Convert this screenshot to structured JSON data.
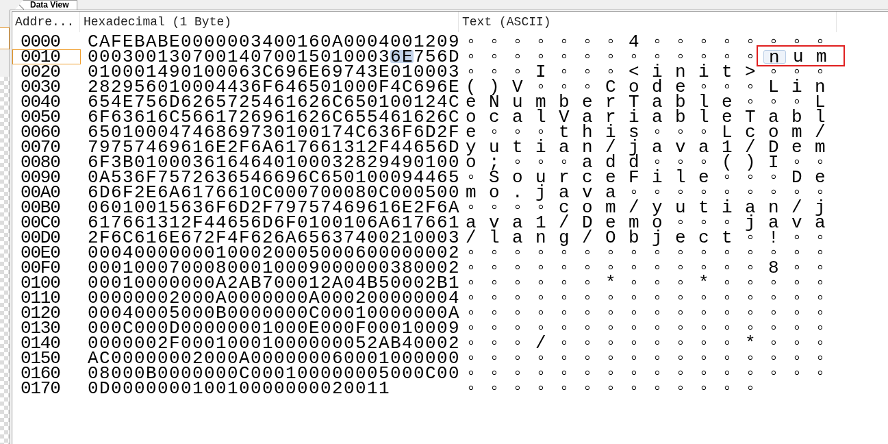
{
  "tabs": [
    {
      "label": "Data View",
      "selected": true
    }
  ],
  "columns": [
    "Addre...",
    "Hexadecimal (1 Byte)",
    "Text (ASCII)"
  ],
  "rows": [
    {
      "address": "0000",
      "current": false,
      "hex": [
        {
          "text": "CAFEBABE0000003400160A0004001209",
          "selected": false
        }
      ],
      "text": [
        {
          "text": "◦ ◦ ◦ ◦ ◦ ◦ ◦ 4 ◦ ◦ ◦ ◦ ◦ ◦ ◦ ◦",
          "selected": false,
          "outlined": false
        }
      ]
    },
    {
      "address": "0010",
      "current": true,
      "hex": [
        {
          "text": "00030013070014070015010003",
          "selected": false
        },
        {
          "text": "6E",
          "selected": true
        },
        {
          "text": "756D",
          "selected": false
        }
      ],
      "text": [
        {
          "text": "◦ ◦ ◦ ◦ ◦ ◦ ◦ ◦ ◦ ◦ ◦ ◦ ◦",
          "selected": false,
          "outlined": false
        },
        {
          "text": "n",
          "selected": true,
          "outlined": true
        },
        {
          "text": "u m",
          "selected": false,
          "outlined": true
        }
      ]
    },
    {
      "address": "0020",
      "current": false,
      "hex": [
        {
          "text": "010001490100063C696E69743E010003",
          "selected": false
        }
      ],
      "text": [
        {
          "text": "◦ ◦ ◦ I ◦ ◦ ◦ < i n i t > ◦ ◦ ◦",
          "selected": false,
          "outlined": false
        }
      ]
    },
    {
      "address": "0030",
      "current": false,
      "hex": [
        {
          "text": "282956010004436F646501000F4C696E",
          "selected": false
        }
      ],
      "text": [
        {
          "text": "( ) V ◦ ◦ ◦ C o d e ◦ ◦ ◦ L i n",
          "selected": false,
          "outlined": false
        }
      ]
    },
    {
      "address": "0040",
      "current": false,
      "hex": [
        {
          "text": "654E756D6265725461626C650100124C",
          "selected": false
        }
      ],
      "text": [
        {
          "text": "e N u m b e r T a b l e ◦ ◦ ◦ L",
          "selected": false,
          "outlined": false
        }
      ]
    },
    {
      "address": "0050",
      "current": false,
      "hex": [
        {
          "text": "6F63616C5661726961626C655461626C",
          "selected": false
        }
      ],
      "text": [
        {
          "text": "o c a l V a r i a b l e T a b l",
          "selected": false,
          "outlined": false
        }
      ]
    },
    {
      "address": "0060",
      "current": false,
      "hex": [
        {
          "text": "65010004746869730100174C636F6D2F",
          "selected": false
        }
      ],
      "text": [
        {
          "text": "e ◦ ◦ ◦ t h i s ◦ ◦ ◦ L c o m /",
          "selected": false,
          "outlined": false
        }
      ]
    },
    {
      "address": "0070",
      "current": false,
      "hex": [
        {
          "text": "79757469616E2F6A617661312F44656D",
          "selected": false
        }
      ],
      "text": [
        {
          "text": "y u t i a n / j a v a 1 / D e m",
          "selected": false,
          "outlined": false
        }
      ]
    },
    {
      "address": "0080",
      "current": false,
      "hex": [
        {
          "text": "6F3B0100036164640100032829490100",
          "selected": false
        }
      ],
      "text": [
        {
          "text": "o ; ◦ ◦ ◦ a d d ◦ ◦ ◦ ( ) I ◦ ◦",
          "selected": false,
          "outlined": false
        }
      ]
    },
    {
      "address": "0090",
      "current": false,
      "hex": [
        {
          "text": "0A536F7572636546696C650100094465",
          "selected": false
        }
      ],
      "text": [
        {
          "text": "◦ S o u r c e F i l e ◦ ◦ ◦ D e",
          "selected": false,
          "outlined": false
        }
      ]
    },
    {
      "address": "00A0",
      "current": false,
      "hex": [
        {
          "text": "6D6F2E6A6176610C000700080C000500",
          "selected": false
        }
      ],
      "text": [
        {
          "text": "m o . j a v a ◦ ◦ ◦ ◦ ◦ ◦ ◦ ◦ ◦",
          "selected": false,
          "outlined": false
        }
      ]
    },
    {
      "address": "00B0",
      "current": false,
      "hex": [
        {
          "text": "06010015636F6D2F79757469616E2F6A",
          "selected": false
        }
      ],
      "text": [
        {
          "text": "◦ ◦ ◦ ◦ c o m / y u t i a n / j",
          "selected": false,
          "outlined": false
        }
      ]
    },
    {
      "address": "00C0",
      "current": false,
      "hex": [
        {
          "text": "617661312F44656D6F0100106A617661",
          "selected": false
        }
      ],
      "text": [
        {
          "text": "a v a 1 / D e m o ◦ ◦ ◦ j a v a",
          "selected": false,
          "outlined": false
        }
      ]
    },
    {
      "address": "00D0",
      "current": false,
      "hex": [
        {
          "text": "2F6C616E672F4F626A65637400210003",
          "selected": false
        }
      ],
      "text": [
        {
          "text": "/ l a n g / O b j e c t ◦ ! ◦ ◦",
          "selected": false,
          "outlined": false
        }
      ]
    },
    {
      "address": "00E0",
      "current": false,
      "hex": [
        {
          "text": "00040000000100020005000600000002",
          "selected": false
        }
      ],
      "text": [
        {
          "text": "◦ ◦ ◦ ◦ ◦ ◦ ◦ ◦ ◦ ◦ ◦ ◦ ◦ ◦ ◦ ◦",
          "selected": false,
          "outlined": false
        }
      ]
    },
    {
      "address": "00F0",
      "current": false,
      "hex": [
        {
          "text": "00010007000800010009000000380002",
          "selected": false
        }
      ],
      "text": [
        {
          "text": "◦ ◦ ◦ ◦ ◦ ◦ ◦ ◦ ◦ ◦ ◦ ◦ ◦ 8 ◦ ◦",
          "selected": false,
          "outlined": false
        }
      ]
    },
    {
      "address": "0100",
      "current": false,
      "hex": [
        {
          "text": "00010000000A2AB700012A04B50002B1",
          "selected": false
        }
      ],
      "text": [
        {
          "text": "◦ ◦ ◦ ◦ ◦ ◦ * ◦ ◦ ◦ * ◦ ◦ ◦ ◦ ◦",
          "selected": false,
          "outlined": false
        }
      ]
    },
    {
      "address": "0110",
      "current": false,
      "hex": [
        {
          "text": "00000002000A0000000A000200000004",
          "selected": false
        }
      ],
      "text": [
        {
          "text": "◦ ◦ ◦ ◦ ◦ ◦ ◦ ◦ ◦ ◦ ◦ ◦ ◦ ◦ ◦ ◦",
          "selected": false,
          "outlined": false
        }
      ]
    },
    {
      "address": "0120",
      "current": false,
      "hex": [
        {
          "text": "00040005000B0000000C00010000000A",
          "selected": false
        }
      ],
      "text": [
        {
          "text": "◦ ◦ ◦ ◦ ◦ ◦ ◦ ◦ ◦ ◦ ◦ ◦ ◦ ◦ ◦ ◦",
          "selected": false,
          "outlined": false
        }
      ]
    },
    {
      "address": "0130",
      "current": false,
      "hex": [
        {
          "text": "000C000D00000001000E000F00010009",
          "selected": false
        }
      ],
      "text": [
        {
          "text": "◦ ◦ ◦ ◦ ◦ ◦ ◦ ◦ ◦ ◦ ◦ ◦ ◦ ◦ ◦ ◦",
          "selected": false,
          "outlined": false
        }
      ]
    },
    {
      "address": "0140",
      "current": false,
      "hex": [
        {
          "text": "0000002F00010001000000052AB40002",
          "selected": false
        }
      ],
      "text": [
        {
          "text": "◦ ◦ ◦ / ◦ ◦ ◦ ◦ ◦ ◦ ◦ ◦ * ◦ ◦ ◦",
          "selected": false,
          "outlined": false
        }
      ]
    },
    {
      "address": "0150",
      "current": false,
      "hex": [
        {
          "text": "AC00000002000A000000060001000000",
          "selected": false
        }
      ],
      "text": [
        {
          "text": "◦ ◦ ◦ ◦ ◦ ◦ ◦ ◦ ◦ ◦ ◦ ◦ ◦ ◦ ◦ ◦",
          "selected": false,
          "outlined": false
        }
      ]
    },
    {
      "address": "0160",
      "current": false,
      "hex": [
        {
          "text": "08000B0000000C000100000005000C00",
          "selected": false
        }
      ],
      "text": [
        {
          "text": "◦ ◦ ◦ ◦ ◦ ◦ ◦ ◦ ◦ ◦ ◦ ◦ ◦ ◦ ◦ ◦",
          "selected": false,
          "outlined": false
        }
      ]
    },
    {
      "address": "0170",
      "current": false,
      "hex": [
        {
          "text": "0D000000010010000000020011",
          "selected": false
        }
      ],
      "text": [
        {
          "text": "◦ ◦ ◦ ◦ ◦ ◦ ◦ ◦ ◦ ◦ ◦ ◦ ◦",
          "selected": false,
          "outlined": false
        }
      ]
    }
  ]
}
